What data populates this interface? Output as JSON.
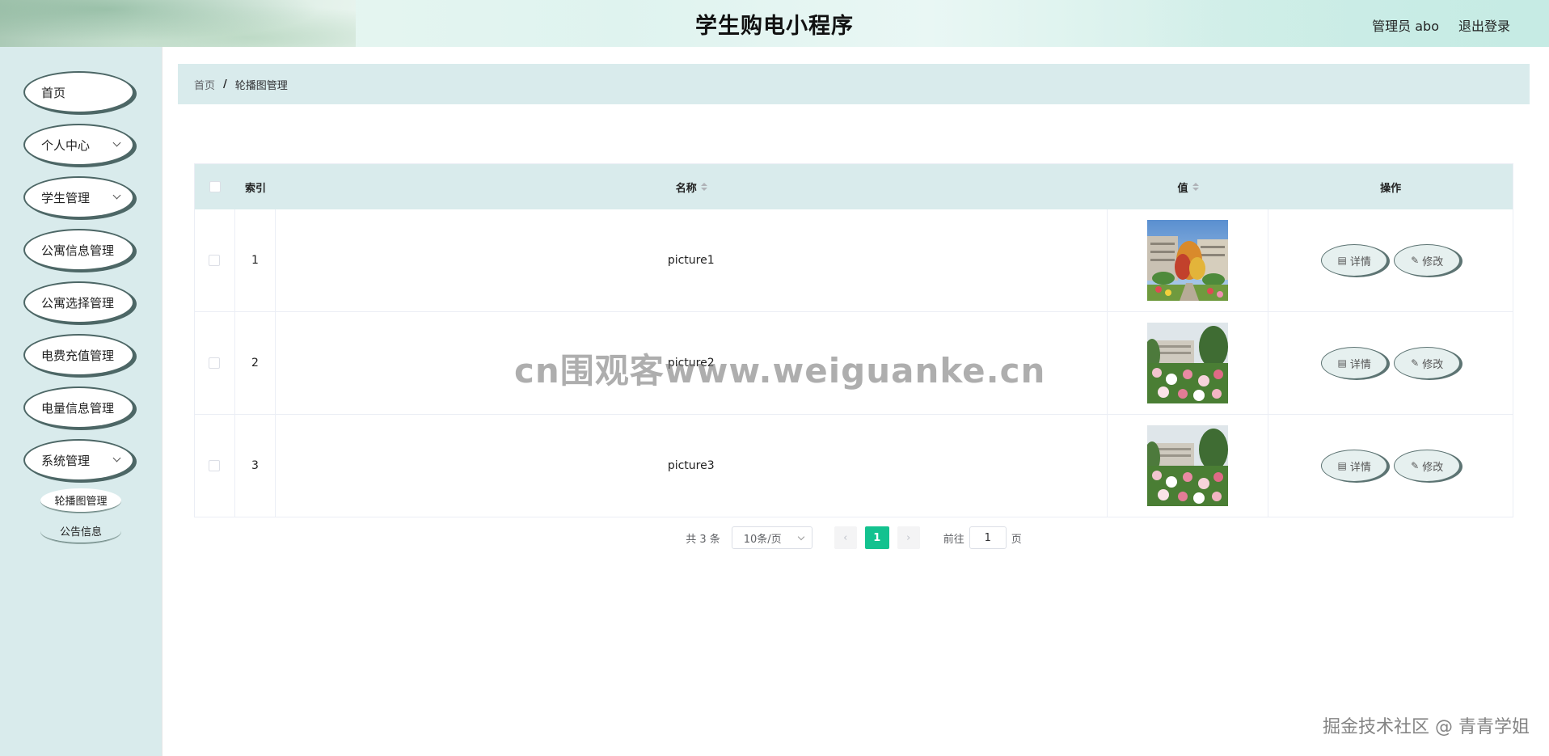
{
  "header": {
    "title": "学生购电小程序",
    "user_label": "管理员 abo",
    "logout_label": "退出登录"
  },
  "sidebar": {
    "items": [
      {
        "label": "首页",
        "has_children": false
      },
      {
        "label": "个人中心",
        "has_children": true
      },
      {
        "label": "学生管理",
        "has_children": true
      },
      {
        "label": "公寓信息管理",
        "has_children": false
      },
      {
        "label": "公寓选择管理",
        "has_children": false
      },
      {
        "label": "电费充值管理",
        "has_children": false
      },
      {
        "label": "电量信息管理",
        "has_children": false
      },
      {
        "label": "系统管理",
        "has_children": true
      }
    ],
    "sub_items": [
      {
        "label": "轮播图管理"
      },
      {
        "label": "公告信息"
      }
    ]
  },
  "breadcrumb": {
    "home": "首页",
    "separator": "/",
    "current": "轮播图管理"
  },
  "table": {
    "columns": {
      "index": "索引",
      "name": "名称",
      "value": "值",
      "ops": "操作"
    },
    "rows": [
      {
        "index": "1",
        "name": "picture1",
        "image": "campus-garden-autumn"
      },
      {
        "index": "2",
        "name": "picture2",
        "image": "campus-flowers"
      },
      {
        "index": "3",
        "name": "picture3",
        "image": "campus-flowers"
      }
    ],
    "detail_label": "详情",
    "edit_label": "修改"
  },
  "pagination": {
    "total": "共 3 条",
    "page_size": "10条/页",
    "current_page": "1",
    "goto_prefix": "前往",
    "goto_value": "1",
    "goto_suffix": "页"
  },
  "watermarks": {
    "center": "cn围观客www.weiguanke.cn",
    "bottom_right": "掘金技术社区 @ 青青学姐"
  },
  "colors": {
    "accent": "#13c28f",
    "sidebar_bg": "#d9ebec",
    "header_bg": "#dff3ef"
  }
}
